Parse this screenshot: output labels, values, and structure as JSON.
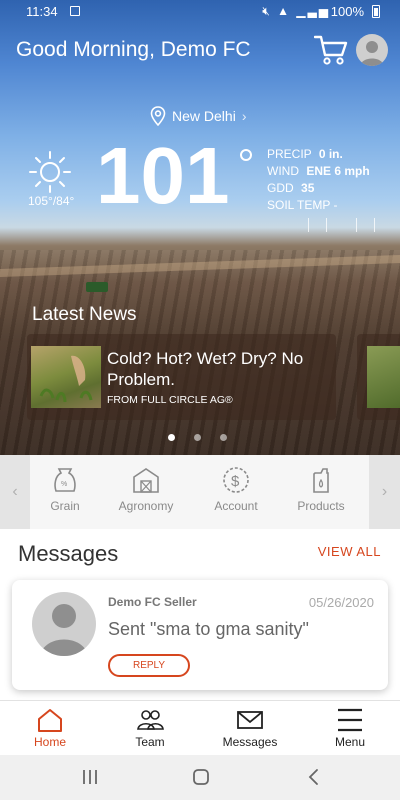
{
  "status_bar": {
    "time": "11:34",
    "battery": "100%"
  },
  "header": {
    "greeting": "Good Morning, Demo FC"
  },
  "weather": {
    "location": "New Delhi",
    "temperature": "101",
    "hi_lo": "105°/84°",
    "precip_label": "PRECIP",
    "precip_value": "0 in.",
    "wind_label": "WIND",
    "wind_value": "ENE 6 mph",
    "gdd_label": "GDD",
    "gdd_value": "35",
    "soil_label": "SOIL TEMP",
    "soil_value": "-"
  },
  "news": {
    "title": "Latest News",
    "items": [
      {
        "headline": "Cold? Hot? Wet? Dry? No Problem.",
        "source": "FROM FULL CIRCLE AG®"
      }
    ],
    "carousel_active": 0,
    "carousel_count": 3
  },
  "categories": [
    {
      "label": "Grain",
      "icon": "grain-bag-icon"
    },
    {
      "label": "Agronomy",
      "icon": "barn-icon"
    },
    {
      "label": "Account",
      "icon": "dollar-coin-icon"
    },
    {
      "label": "Products",
      "icon": "fuel-jug-icon"
    }
  ],
  "messages": {
    "title": "Messages",
    "view_all": "VIEW ALL",
    "items": [
      {
        "sender": "Demo FC Seller",
        "date": "05/26/2020",
        "text": "Sent \"sma to gma sanity\"",
        "reply_label": "REPLY"
      }
    ]
  },
  "tabs": [
    {
      "label": "Home",
      "icon": "home-icon",
      "active": true
    },
    {
      "label": "Team",
      "icon": "team-icon",
      "active": false
    },
    {
      "label": "Messages",
      "icon": "envelope-icon",
      "active": false
    },
    {
      "label": "Menu",
      "icon": "hamburger-menu-icon",
      "active": false
    }
  ],
  "colors": {
    "accent": "#d6461e",
    "sky": "#4f86d2",
    "white": "#ffffff"
  }
}
